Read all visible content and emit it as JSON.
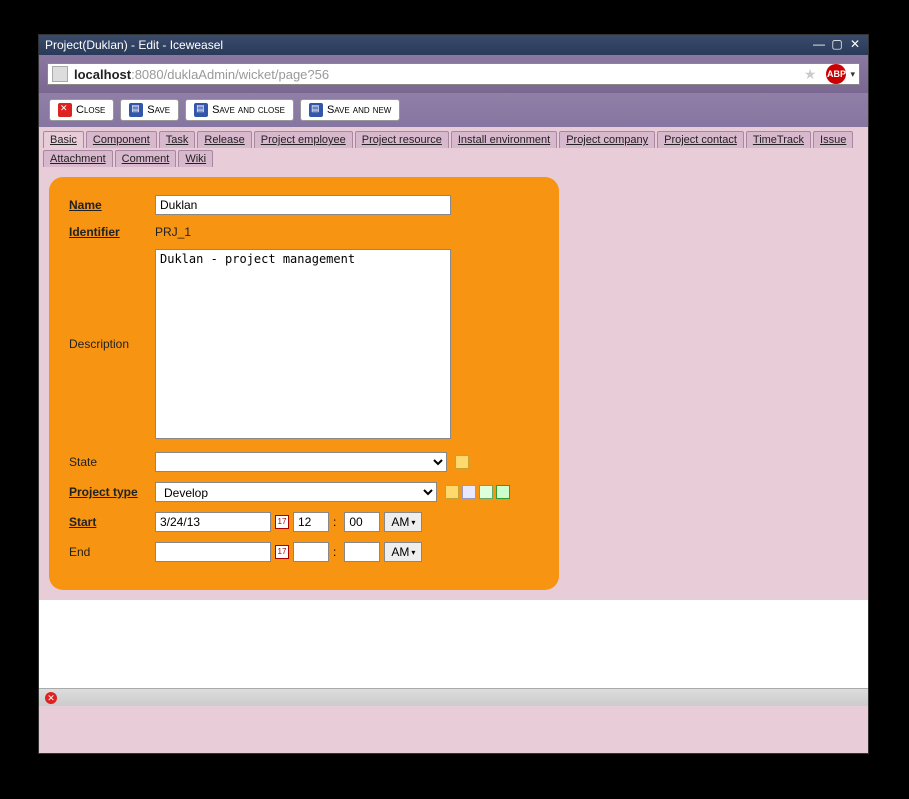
{
  "window": {
    "title": "Project(Duklan) - Edit - Iceweasel"
  },
  "address": {
    "host": "localhost",
    "rest": ":8080/duklaAdmin/wicket/page?56"
  },
  "toolbar": {
    "close": "Close",
    "save": "Save",
    "saveclose": "Save and close",
    "savenew": "Save and new"
  },
  "tabs": {
    "basic": "Basic",
    "component": "Component",
    "task": "Task",
    "release": "Release",
    "projemp": "Project employee",
    "projres": "Project resource",
    "install": "Install environment",
    "projcomp": "Project company",
    "projcont": "Project contact",
    "timetrack": "TimeTrack",
    "issue": "Issue",
    "attach": "Attachment",
    "comment": "Comment",
    "wiki": "Wiki"
  },
  "form": {
    "labels": {
      "name": "Name",
      "identifier": "Identifier",
      "description": "Description",
      "state": "State",
      "ptype": "Project type",
      "start": "Start",
      "end": "End"
    },
    "name_value": "Duklan",
    "identifier_value": "PRJ_1",
    "description_value": "Duklan - project management",
    "state_value": "",
    "ptype_value": "Develop",
    "start_date": "3/24/13",
    "start_hh": "12",
    "start_mm": "00",
    "start_ampm": "AM",
    "end_date": "",
    "end_hh": "",
    "end_mm": "",
    "end_ampm": "AM",
    "cal_text": "17"
  }
}
